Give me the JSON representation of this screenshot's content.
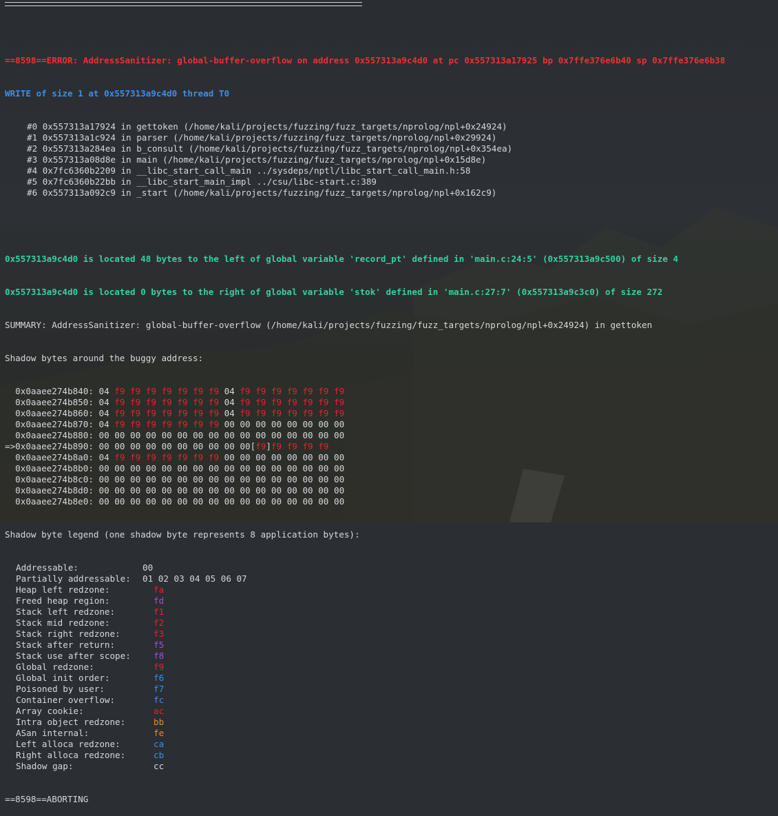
{
  "terminal": {
    "error_header": "==8598==ERROR: AddressSanitizer: global-buffer-overflow on address 0x557313a9c4d0 at pc 0x557313a17925 bp 0x7ffe376e6b40 sp 0x7ffe376e6b38",
    "write_line": "WRITE of size 1 at 0x557313a9c4d0 thread T0",
    "stack": [
      "#0 0x557313a17924 in gettoken (/home/kali/projects/fuzzing/fuzz_targets/nprolog/npl+0x24924)",
      "#1 0x557313a1c924 in parser (/home/kali/projects/fuzzing/fuzz_targets/nprolog/npl+0x29924)",
      "#2 0x557313a284ea in b_consult (/home/kali/projects/fuzzing/fuzz_targets/nprolog/npl+0x354ea)",
      "#3 0x557313a08d8e in main (/home/kali/projects/fuzzing/fuzz_targets/nprolog/npl+0x15d8e)",
      "#4 0x7fc6360b2209 in __libc_start_call_main ../sysdeps/nptl/libc_start_call_main.h:58",
      "#5 0x7fc6360b22bb in __libc_start_main_impl ../csu/libc-start.c:389",
      "#6 0x557313a092c9 in _start (/home/kali/projects/fuzzing/fuzz_targets/nprolog/npl+0x162c9)"
    ],
    "located_1": "0x557313a9c4d0 is located 48 bytes to the left of global variable 'record_pt' defined in 'main.c:24:5' (0x557313a9c500) of size 4",
    "located_2": "0x557313a9c4d0 is located 0 bytes to the right of global variable 'stok' defined in 'main.c:27:7' (0x557313a9c3c0) of size 272",
    "summary": "SUMMARY: AddressSanitizer: global-buffer-overflow (/home/kali/projects/fuzzing/fuzz_targets/nprolog/npl+0x24924) in gettoken",
    "shadow_header": "Shadow bytes around the buggy address:",
    "shadow_rows": [
      {
        "prefix": "  ",
        "addr": "0x0aaee274b840:",
        "cells": [
          "04",
          "f9",
          "f9",
          "f9",
          "f9",
          "f9",
          "f9",
          "f9",
          "04",
          "f9",
          "f9",
          "f9",
          "f9",
          "f9",
          "f9",
          "f9"
        ]
      },
      {
        "prefix": "  ",
        "addr": "0x0aaee274b850:",
        "cells": [
          "04",
          "f9",
          "f9",
          "f9",
          "f9",
          "f9",
          "f9",
          "f9",
          "04",
          "f9",
          "f9",
          "f9",
          "f9",
          "f9",
          "f9",
          "f9"
        ]
      },
      {
        "prefix": "  ",
        "addr": "0x0aaee274b860:",
        "cells": [
          "04",
          "f9",
          "f9",
          "f9",
          "f9",
          "f9",
          "f9",
          "f9",
          "04",
          "f9",
          "f9",
          "f9",
          "f9",
          "f9",
          "f9",
          "f9"
        ]
      },
      {
        "prefix": "  ",
        "addr": "0x0aaee274b870:",
        "cells": [
          "04",
          "f9",
          "f9",
          "f9",
          "f9",
          "f9",
          "f9",
          "f9",
          "00",
          "00",
          "00",
          "00",
          "00",
          "00",
          "00",
          "00"
        ]
      },
      {
        "prefix": "  ",
        "addr": "0x0aaee274b880:",
        "cells": [
          "00",
          "00",
          "00",
          "00",
          "00",
          "00",
          "00",
          "00",
          "00",
          "00",
          "00",
          "00",
          "00",
          "00",
          "00",
          "00"
        ]
      },
      {
        "prefix": "=>",
        "addr": "0x0aaee274b890:",
        "cells": [
          "00",
          "00",
          "00",
          "00",
          "00",
          "00",
          "00",
          "00",
          "00",
          "00",
          "[f9]",
          "f9",
          "f9",
          "f9",
          "f9"
        ]
      },
      {
        "prefix": "  ",
        "addr": "0x0aaee274b8a0:",
        "cells": [
          "04",
          "f9",
          "f9",
          "f9",
          "f9",
          "f9",
          "f9",
          "f9",
          "00",
          "00",
          "00",
          "00",
          "00",
          "00",
          "00",
          "00"
        ]
      },
      {
        "prefix": "  ",
        "addr": "0x0aaee274b8b0:",
        "cells": [
          "00",
          "00",
          "00",
          "00",
          "00",
          "00",
          "00",
          "00",
          "00",
          "00",
          "00",
          "00",
          "00",
          "00",
          "00",
          "00"
        ]
      },
      {
        "prefix": "  ",
        "addr": "0x0aaee274b8c0:",
        "cells": [
          "00",
          "00",
          "00",
          "00",
          "00",
          "00",
          "00",
          "00",
          "00",
          "00",
          "00",
          "00",
          "00",
          "00",
          "00",
          "00"
        ]
      },
      {
        "prefix": "  ",
        "addr": "0x0aaee274b8d0:",
        "cells": [
          "00",
          "00",
          "00",
          "00",
          "00",
          "00",
          "00",
          "00",
          "00",
          "00",
          "00",
          "00",
          "00",
          "00",
          "00",
          "00"
        ]
      },
      {
        "prefix": "  ",
        "addr": "0x0aaee274b8e0:",
        "cells": [
          "00",
          "00",
          "00",
          "00",
          "00",
          "00",
          "00",
          "00",
          "00",
          "00",
          "00",
          "00",
          "00",
          "00",
          "00",
          "00"
        ]
      }
    ],
    "legend_header": "Shadow byte legend (one shadow byte represents 8 application bytes):",
    "legend": [
      {
        "label": "Addressable:",
        "value": "00",
        "color": "#d6d8dc",
        "pad": 0
      },
      {
        "label": "Partially addressable:",
        "value": "01 02 03 04 05 06 07",
        "color": "#d6d8dc",
        "pad": 0
      },
      {
        "label": "Heap left redzone:",
        "value": "fa",
        "color": "#e8212c",
        "pad": 1
      },
      {
        "label": "Freed heap region:",
        "value": "fd",
        "color": "#a54ed8",
        "pad": 1
      },
      {
        "label": "Stack left redzone:",
        "value": "f1",
        "color": "#e8212c",
        "pad": 1
      },
      {
        "label": "Stack mid redzone:",
        "value": "f2",
        "color": "#e8212c",
        "pad": 1
      },
      {
        "label": "Stack right redzone:",
        "value": "f3",
        "color": "#e8212c",
        "pad": 1
      },
      {
        "label": "Stack after return:",
        "value": "f5",
        "color": "#a54ed8",
        "pad": 1
      },
      {
        "label": "Stack use after scope:",
        "value": "f8",
        "color": "#a54ed8",
        "pad": 1
      },
      {
        "label": "Global redzone:",
        "value": "f9",
        "color": "#e8212c",
        "pad": 1
      },
      {
        "label": "Global init order:",
        "value": "f6",
        "color": "#3b8eea",
        "pad": 1
      },
      {
        "label": "Poisoned by user:",
        "value": "f7",
        "color": "#3b8eea",
        "pad": 1
      },
      {
        "label": "Container overflow:",
        "value": "fc",
        "color": "#3b8eea",
        "pad": 1
      },
      {
        "label": "Array cookie:",
        "value": "ac",
        "color": "#e8212c",
        "pad": 1
      },
      {
        "label": "Intra object redzone:",
        "value": "bb",
        "color": "#f08a24",
        "pad": 1
      },
      {
        "label": "ASan internal:",
        "value": "fe",
        "color": "#f08a24",
        "pad": 1
      },
      {
        "label": "Left alloca redzone:",
        "value": "ca",
        "color": "#3b8eea",
        "pad": 1
      },
      {
        "label": "Right alloca redzone:",
        "value": "cb",
        "color": "#3b8eea",
        "pad": 1
      },
      {
        "label": "Shadow gap:",
        "value": "cc",
        "color": "#d6d8dc",
        "pad": 1
      }
    ],
    "aborting": "==8598==ABORTING"
  },
  "colors": {
    "error_red": "#f0302f",
    "write_blue": "#3b8eea",
    "located_teal": "#34d1a2",
    "poison_red": "#e8212c",
    "text": "#d6d8dc"
  }
}
